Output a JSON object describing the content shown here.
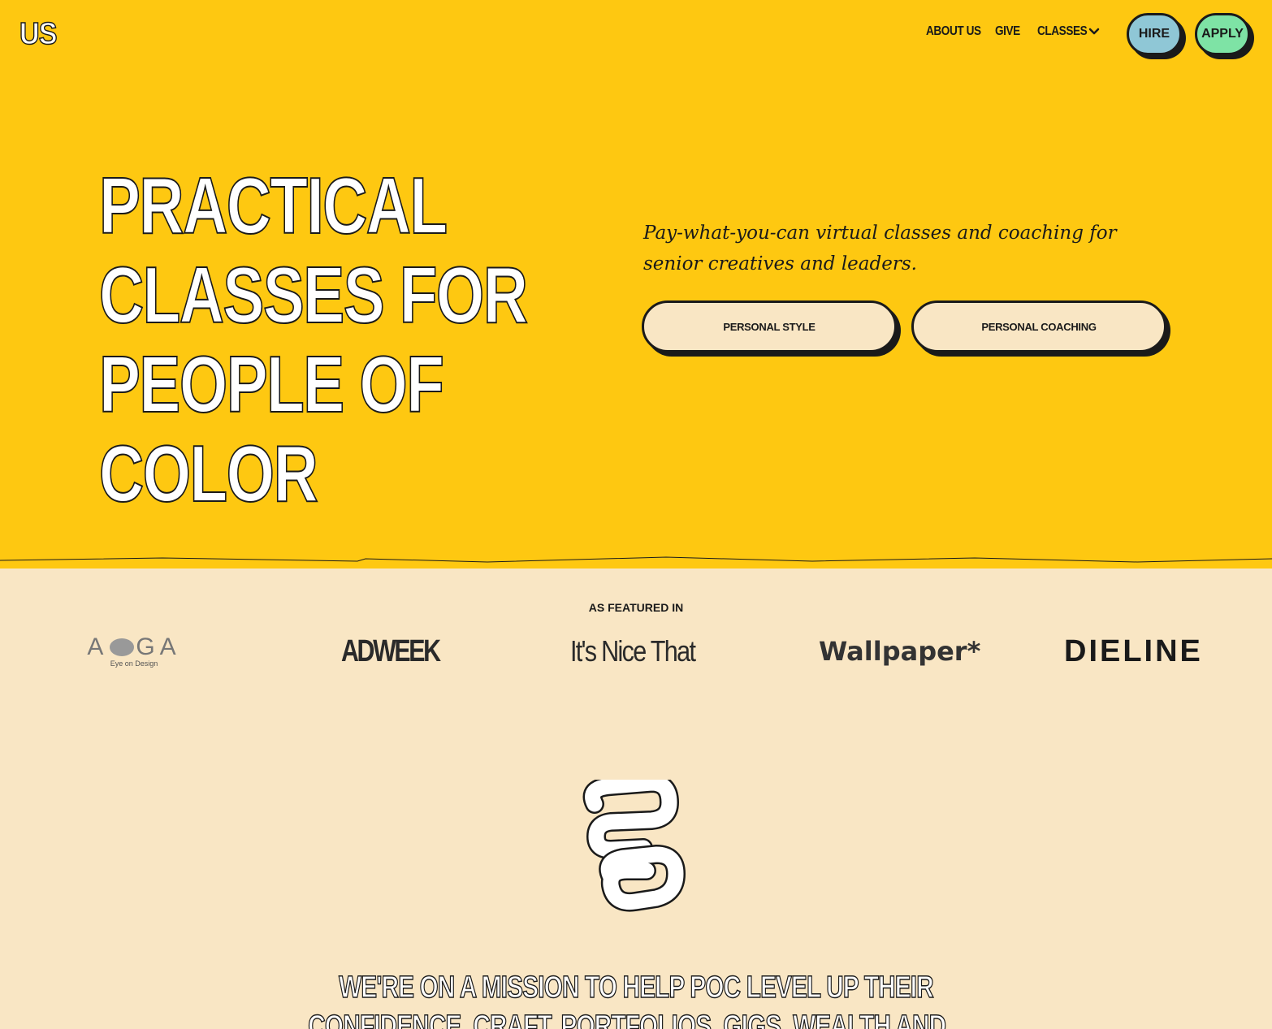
{
  "header": {
    "logo_text": "US",
    "nav": {
      "about": "ABOUT US",
      "give": "GIVE",
      "classes": "CLASSES"
    },
    "hire_label": "HIRE",
    "apply_label": "APPLY"
  },
  "hero": {
    "headline_line1": "PRACTICAL",
    "headline_line2": "CLASSES FOR",
    "headline_line3": "PEOPLE OF COLOR",
    "subtext": "Pay-what-you-can virtual classes and coaching for senior creatives and leaders.",
    "cta_style": "PERSONAL STYLE",
    "cta_coaching": "PERSONAL COACHING"
  },
  "featured": {
    "label": "AS FEATURED IN",
    "brands": {
      "aiga_letters_left": "A",
      "aiga_letters_right": "GA",
      "aiga_sub": "Eye on Design",
      "adweek": "ADWEEK",
      "nice": "It's Nice That",
      "wallpaper": "Wallpaper*",
      "dieline": "DIELINE"
    }
  },
  "mission": {
    "text": "WE'RE ON A MISSION TO HELP POC LEVEL UP THEIR CONFIDENCE, CRAFT, PORTFOLIOS, GIGS, WEALTH AND..."
  },
  "colors": {
    "hero_bg": "#fec811",
    "page_bg": "#f9e6c4",
    "hire_bg": "#8fc7d6",
    "apply_bg": "#7ee3a5",
    "ink": "#1a1a1a"
  },
  "icons": [
    "chevron-down-icon",
    "us-mark-icon"
  ]
}
